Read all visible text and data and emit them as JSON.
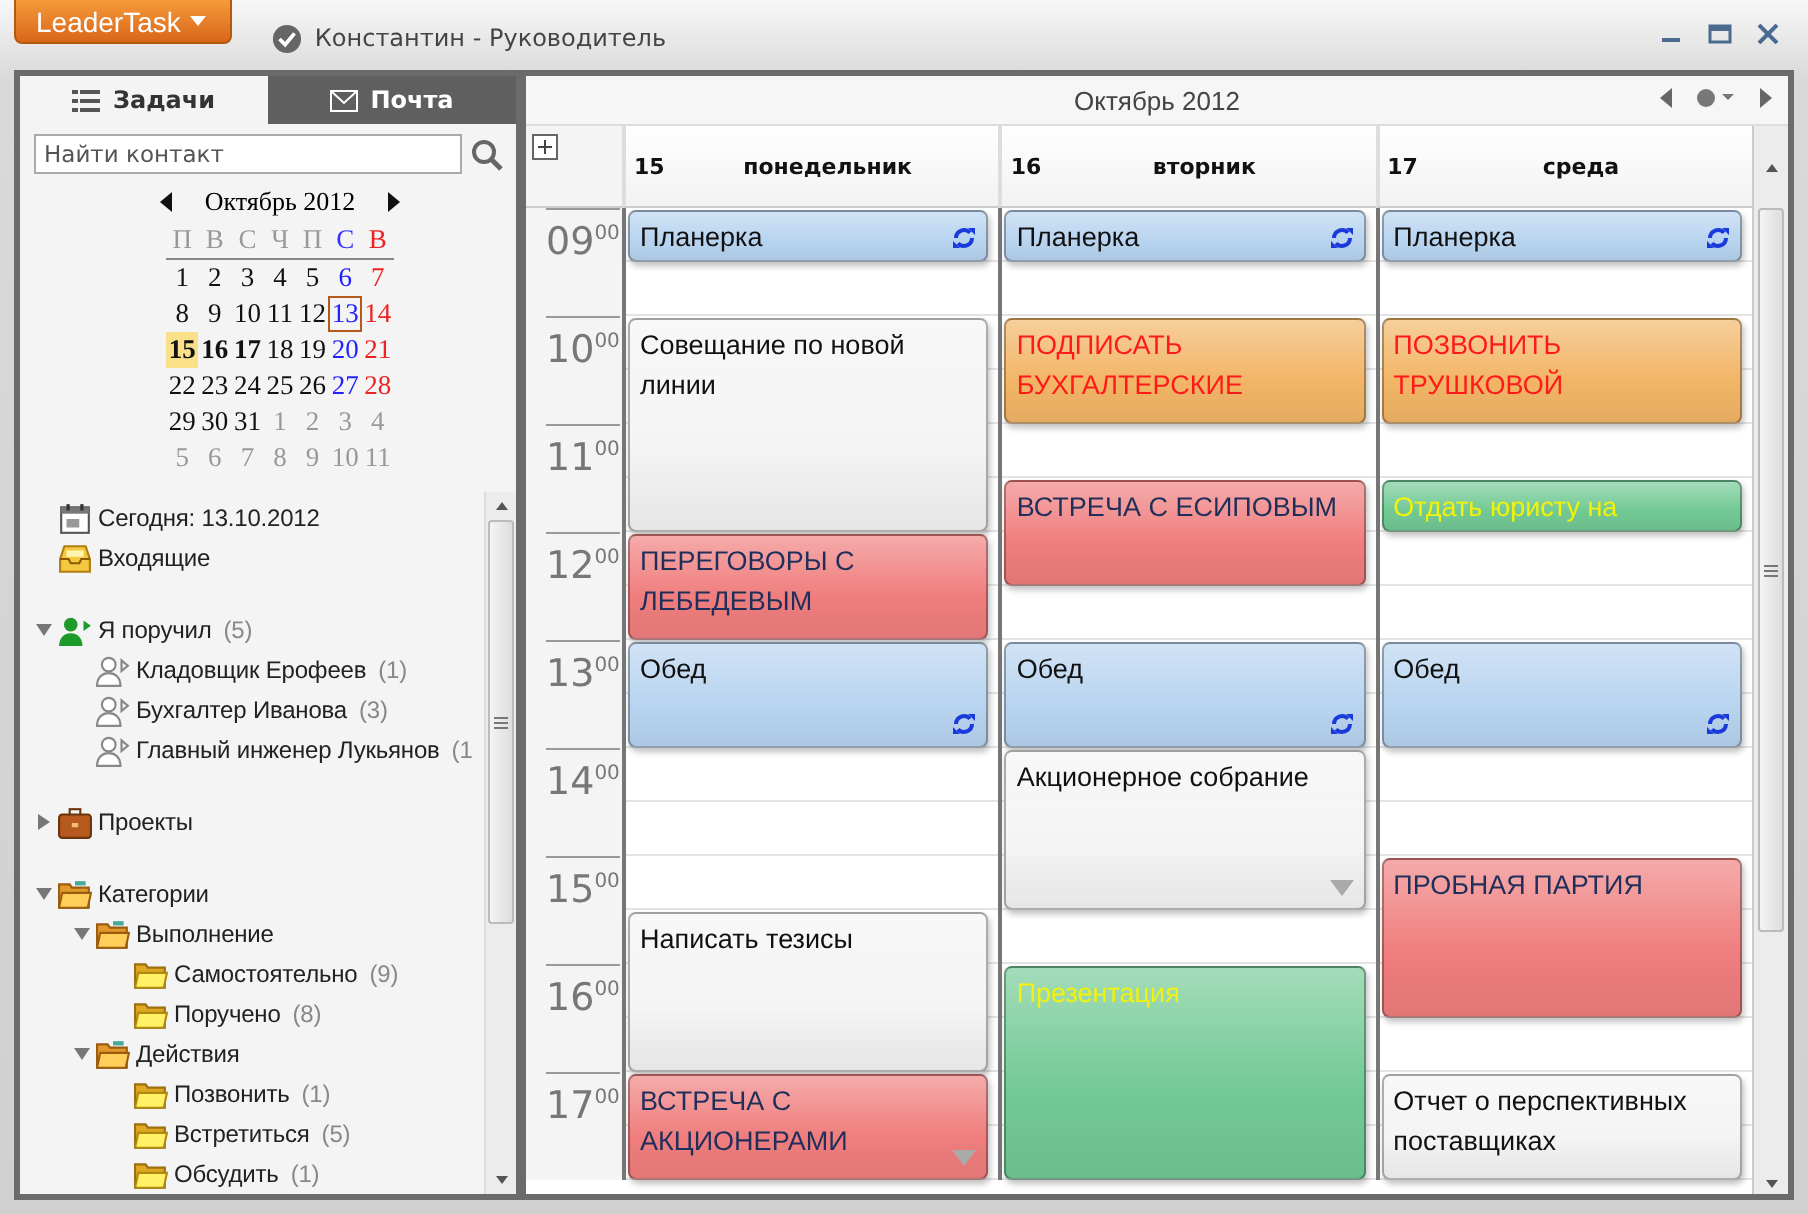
{
  "app_menu": {
    "label": "LeaderTask"
  },
  "window": {
    "title": "Константин - Руководитель"
  },
  "tabs": [
    {
      "label": "Задачи",
      "kind": "tasks",
      "selected": true
    },
    {
      "label": "Почта",
      "kind": "mail",
      "selected": false
    }
  ],
  "search": {
    "placeholder": "Найти контакт"
  },
  "mini_calendar": {
    "title": "Октябрь 2012",
    "weekdays": [
      "П",
      "В",
      "С",
      "Ч",
      "П",
      "С",
      "В"
    ],
    "weeks": [
      [
        {
          "day": "1",
          "muted": false,
          "today": false,
          "selected": false,
          "bold": false
        },
        {
          "day": "2",
          "muted": false,
          "today": false,
          "selected": false,
          "bold": false
        },
        {
          "day": "3",
          "muted": false,
          "today": false,
          "selected": false,
          "bold": false
        },
        {
          "day": "4",
          "muted": false,
          "today": false,
          "selected": false,
          "bold": false
        },
        {
          "day": "5",
          "muted": false,
          "today": false,
          "selected": false,
          "bold": false
        },
        {
          "day": "6",
          "muted": false,
          "today": false,
          "selected": false,
          "bold": false
        },
        {
          "day": "7",
          "muted": false,
          "today": false,
          "selected": false,
          "bold": false
        }
      ],
      [
        {
          "day": "8",
          "muted": false,
          "today": false,
          "selected": false,
          "bold": false
        },
        {
          "day": "9",
          "muted": false,
          "today": false,
          "selected": false,
          "bold": false
        },
        {
          "day": "10",
          "muted": false,
          "today": false,
          "selected": false,
          "bold": false
        },
        {
          "day": "11",
          "muted": false,
          "today": false,
          "selected": false,
          "bold": false
        },
        {
          "day": "12",
          "muted": false,
          "today": false,
          "selected": false,
          "bold": false
        },
        {
          "day": "13",
          "muted": false,
          "today": true,
          "selected": false,
          "bold": false
        },
        {
          "day": "14",
          "muted": false,
          "today": false,
          "selected": false,
          "bold": false
        }
      ],
      [
        {
          "day": "15",
          "muted": false,
          "today": false,
          "selected": true,
          "bold": true
        },
        {
          "day": "16",
          "muted": false,
          "today": false,
          "selected": false,
          "bold": true
        },
        {
          "day": "17",
          "muted": false,
          "today": false,
          "selected": false,
          "bold": true
        },
        {
          "day": "18",
          "muted": false,
          "today": false,
          "selected": false,
          "bold": false
        },
        {
          "day": "19",
          "muted": false,
          "today": false,
          "selected": false,
          "bold": false
        },
        {
          "day": "20",
          "muted": false,
          "today": false,
          "selected": false,
          "bold": false
        },
        {
          "day": "21",
          "muted": false,
          "today": false,
          "selected": false,
          "bold": false
        }
      ],
      [
        {
          "day": "22",
          "muted": false,
          "today": false,
          "selected": false,
          "bold": false
        },
        {
          "day": "23",
          "muted": false,
          "today": false,
          "selected": false,
          "bold": false
        },
        {
          "day": "24",
          "muted": false,
          "today": false,
          "selected": false,
          "bold": false
        },
        {
          "day": "25",
          "muted": false,
          "today": false,
          "selected": false,
          "bold": false
        },
        {
          "day": "26",
          "muted": false,
          "today": false,
          "selected": false,
          "bold": false
        },
        {
          "day": "27",
          "muted": false,
          "today": false,
          "selected": false,
          "bold": false
        },
        {
          "day": "28",
          "muted": false,
          "today": false,
          "selected": false,
          "bold": false
        }
      ],
      [
        {
          "day": "29",
          "muted": false,
          "today": false,
          "selected": false,
          "bold": false
        },
        {
          "day": "30",
          "muted": false,
          "today": false,
          "selected": false,
          "bold": false
        },
        {
          "day": "31",
          "muted": false,
          "today": false,
          "selected": false,
          "bold": false
        },
        {
          "day": "1",
          "muted": true,
          "today": false,
          "selected": false,
          "bold": false
        },
        {
          "day": "2",
          "muted": true,
          "today": false,
          "selected": false,
          "bold": false
        },
        {
          "day": "3",
          "muted": true,
          "today": false,
          "selected": false,
          "bold": false
        },
        {
          "day": "4",
          "muted": true,
          "today": false,
          "selected": false,
          "bold": false
        }
      ],
      [
        {
          "day": "5",
          "muted": true,
          "today": false,
          "selected": false,
          "bold": false
        },
        {
          "day": "6",
          "muted": true,
          "today": false,
          "selected": false,
          "bold": false
        },
        {
          "day": "7",
          "muted": true,
          "today": false,
          "selected": false,
          "bold": false
        },
        {
          "day": "8",
          "muted": true,
          "today": false,
          "selected": false,
          "bold": false
        },
        {
          "day": "9",
          "muted": true,
          "today": false,
          "selected": false,
          "bold": false
        },
        {
          "day": "10",
          "muted": true,
          "today": false,
          "selected": false,
          "bold": false
        },
        {
          "day": "11",
          "muted": true,
          "today": false,
          "selected": false,
          "bold": false
        }
      ]
    ]
  },
  "sidebar": {
    "sections": [
      [
        {
          "label": "Сегодня: 13.10.2012",
          "kind": "calendar"
        },
        {
          "label": "Входящие",
          "kind": "inbox"
        }
      ],
      [
        {
          "label": "Я поручил",
          "count": "(5)",
          "kind": "delegated",
          "expanded": true,
          "children": [
            {
              "label": "Кладовщик Ерофеев",
              "count": "(1)",
              "kind": "contact"
            },
            {
              "label": "Бухгалтер Иванова",
              "count": "(3)",
              "kind": "contact"
            },
            {
              "label": "Главный инженер Лукьянов",
              "count": "(1",
              "kind": "contact"
            }
          ]
        }
      ],
      [
        {
          "label": "Проекты",
          "kind": "briefcase",
          "expanded": false
        }
      ],
      [
        {
          "label": "Категории",
          "kind": "category",
          "expanded": true,
          "children": [
            {
              "label": "Выполнение",
              "kind": "category",
              "expanded": true,
              "children": [
                {
                  "label": "Самостоятельно",
                  "count": "(9)",
                  "kind": "folder"
                },
                {
                  "label": "Поручено",
                  "count": "(8)",
                  "kind": "folder"
                }
              ]
            },
            {
              "label": "Действия",
              "kind": "category",
              "expanded": true,
              "children": [
                {
                  "label": "Позвонить",
                  "count": "(1)",
                  "kind": "folder"
                },
                {
                  "label": "Встретиться",
                  "count": "(5)",
                  "kind": "folder"
                },
                {
                  "label": "Обсудить",
                  "count": "(1)",
                  "kind": "folder"
                }
              ]
            }
          ]
        }
      ]
    ]
  },
  "calendar": {
    "title": "Октябрь 2012",
    "hours": [
      "09$^{00}$",
      "10$^{00}$",
      "11$^{00}$",
      "12$^{00}$",
      "13$^{00}$",
      "14$^{00}$",
      "15$^{00}$",
      "16$^{00}$",
      "17$^{00}$"
    ],
    "days": [
      {
        "number": "15",
        "weekday": "понедельник",
        "events": [
          {
            "title": "Планерка",
            "kind": "routine",
            "color": "#b8d4f0",
            "recurring": true,
            "more": false
          },
          {
            "title": "Совещание по новой линии",
            "kind": "plain",
            "color": "#f4f4f4",
            "recurring": false,
            "more": false
          },
          {
            "title": "ПЕРЕГОВОРЫ С ЛЕБЕДЕВЫМ",
            "kind": "urgent",
            "color": "#f07d7d",
            "recurring": false,
            "more": false
          },
          {
            "title": "Обед",
            "kind": "routine",
            "color": "#b8d4f0",
            "recurring": true,
            "more": false
          },
          {
            "title": "Написать тезисы",
            "kind": "plain",
            "color": "#f4f4f4",
            "recurring": false,
            "more": false
          },
          {
            "title": "ВСТРЕЧА С АКЦИОНЕРАМИ",
            "kind": "urgent",
            "color": "#f07d7d",
            "recurring": false,
            "more": true
          }
        ]
      },
      {
        "number": "16",
        "weekday": "вторник",
        "events": [
          {
            "title": "Планерка",
            "kind": "routine",
            "color": "#b8d4f0",
            "recurring": true,
            "more": false
          },
          {
            "title": "ПОДПИСАТЬ БУХГАЛТЕРСКИЕ",
            "kind": "call",
            "color": "#f2b566",
            "recurring": false,
            "more": false
          },
          {
            "title": "ВСТРЕЧА С ЕСИПОВЫМ",
            "kind": "urgent",
            "color": "#f07d7d",
            "recurring": false,
            "more": false
          },
          {
            "title": "Обед",
            "kind": "routine",
            "color": "#b8d4f0",
            "recurring": true,
            "more": false
          },
          {
            "title": "Акционерное собрание",
            "kind": "plain",
            "color": "#f4f4f4",
            "recurring": false,
            "more": true
          },
          {
            "title": "Презентация",
            "kind": "task",
            "color": "#72c994",
            "recurring": false,
            "more": false
          }
        ]
      },
      {
        "number": "17",
        "weekday": "среда",
        "events": [
          {
            "title": "Планерка",
            "kind": "routine",
            "color": "#b8d4f0",
            "recurring": true,
            "more": false
          },
          {
            "title": "ПОЗВОНИТЬ ТРУШКОВОЙ",
            "kind": "call",
            "color": "#f2b566",
            "recurring": false,
            "more": false
          },
          {
            "title": "Отдать юристу на",
            "kind": "task",
            "color": "#72c994",
            "recurring": false,
            "more": false
          },
          {
            "title": "Обед",
            "kind": "routine",
            "color": "#b8d4f0",
            "recurring": true,
            "more": false
          },
          {
            "title": "ПРОБНАЯ ПАРТИЯ",
            "kind": "urgent",
            "color": "#f07d7d",
            "recurring": false,
            "more": false
          },
          {
            "title": "Отчет о перспективных поставщиках",
            "kind": "plain",
            "color": "#f4f4f4",
            "recurring": false,
            "more": false
          }
        ]
      }
    ]
  }
}
